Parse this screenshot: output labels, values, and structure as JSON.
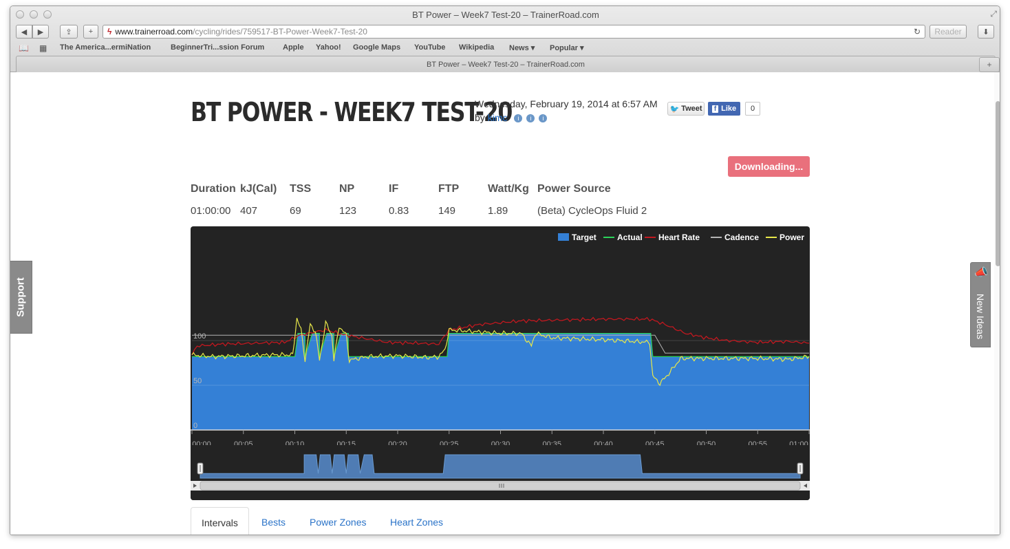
{
  "window": {
    "title": "BT Power – Week7 Test-20 – TrainerRoad.com"
  },
  "toolbar": {
    "url_host": "www.trainerroad.com",
    "url_path": "/cycling/rides/759517-BT-Power-Week7-Test-20",
    "reader_label": "Reader",
    "back_glyph": "◀",
    "forward_glyph": "▶",
    "share_glyph": "⇪",
    "add_glyph": "+",
    "reload_glyph": "↻",
    "download_glyph": "⬇"
  },
  "bookmarks": {
    "items": [
      "The America...ermiNation",
      "BeginnerTri...ssion Forum",
      "Apple",
      "Yahoo!",
      "Google Maps",
      "YouTube",
      "Wikipedia",
      "News ▾",
      "Popular ▾"
    ]
  },
  "tab": {
    "title": "BT Power – Week7 Test-20 – TrainerRoad.com"
  },
  "ride": {
    "title": "BT POWER - WEEK7 TEST-20",
    "date": "Wednesday, February 19, 2014 at 6:57 AM",
    "by_prefix": "by",
    "author": "kimc"
  },
  "social": {
    "tweet_label": "Tweet",
    "like_label": "Like",
    "like_count": "0"
  },
  "actions": {
    "download_label": "Downloading..."
  },
  "stats": {
    "headers": [
      "Duration",
      "kJ(Cal)",
      "TSS",
      "NP",
      "IF",
      "FTP",
      "Watt/Kg",
      "Power Source"
    ],
    "values": [
      "01:00:00",
      "407",
      "69",
      "123",
      "0.83",
      "149",
      "1.89",
      "(Beta) CycleOps Fluid 2"
    ]
  },
  "chart_data": {
    "type": "area",
    "legend": [
      "Target",
      "Actual",
      "Heart Rate",
      "Cadence",
      "Power"
    ],
    "colors": {
      "background": "#232323",
      "target": "#3480d6",
      "actual": "#2bd45a",
      "heart_rate": "#c2181f",
      "cadence": "#b4b4b4",
      "power": "#e8e84a"
    },
    "y_ticks": [
      "100",
      "50",
      "0"
    ],
    "x_tick_labels": [
      "00:00",
      "00:05",
      "00:10",
      "00:15",
      "00:20",
      "00:25",
      "00:30",
      "00:35",
      "00:40",
      "00:45",
      "00:50",
      "00:55",
      "01:00"
    ],
    "xlim_minutes": [
      0,
      60
    ],
    "target_pct": [
      [
        0,
        82
      ],
      [
        10,
        82
      ],
      [
        10.3,
        108
      ],
      [
        11,
        108
      ],
      [
        11,
        82
      ],
      [
        11.7,
        108
      ],
      [
        12.4,
        108
      ],
      [
        12.4,
        82
      ],
      [
        13.1,
        108
      ],
      [
        13.8,
        108
      ],
      [
        13.8,
        82
      ],
      [
        14.5,
        108
      ],
      [
        15.2,
        108
      ],
      [
        15.2,
        82
      ],
      [
        24.8,
        82
      ],
      [
        25,
        108
      ],
      [
        44.6,
        108
      ],
      [
        44.8,
        82
      ],
      [
        60,
        82
      ]
    ],
    "power_pct": [
      [
        0,
        84
      ],
      [
        2,
        82
      ],
      [
        5,
        83
      ],
      [
        8,
        84
      ],
      [
        9.8,
        84
      ],
      [
        10.2,
        125
      ],
      [
        10.6,
        112
      ],
      [
        11,
        78
      ],
      [
        11.5,
        118
      ],
      [
        12,
        110
      ],
      [
        12.4,
        78
      ],
      [
        13,
        120
      ],
      [
        13.6,
        106
      ],
      [
        13.8,
        78
      ],
      [
        14.3,
        116
      ],
      [
        15,
        106
      ],
      [
        15.3,
        78
      ],
      [
        17,
        82
      ],
      [
        20,
        83
      ],
      [
        23,
        81
      ],
      [
        24,
        82
      ],
      [
        24.6,
        90
      ],
      [
        25,
        112
      ],
      [
        30,
        108
      ],
      [
        32,
        108
      ],
      [
        33,
        94
      ],
      [
        33.4,
        108
      ],
      [
        35,
        103
      ],
      [
        40,
        101
      ],
      [
        44.5,
        98
      ],
      [
        44.8,
        60
      ],
      [
        45.5,
        52
      ],
      [
        46.5,
        65
      ],
      [
        47.5,
        80
      ],
      [
        50,
        80
      ],
      [
        55,
        80
      ],
      [
        58,
        79
      ],
      [
        60,
        82
      ]
    ],
    "heart_rate_pct": [
      [
        0,
        84
      ],
      [
        0.5,
        94
      ],
      [
        3,
        96
      ],
      [
        6,
        97
      ],
      [
        9,
        98
      ],
      [
        10.5,
        106
      ],
      [
        13,
        112
      ],
      [
        15,
        106
      ],
      [
        17,
        102
      ],
      [
        19,
        98
      ],
      [
        22,
        97
      ],
      [
        24,
        96
      ],
      [
        25,
        112
      ],
      [
        28,
        118
      ],
      [
        32,
        122
      ],
      [
        36,
        123
      ],
      [
        40,
        124
      ],
      [
        44.5,
        124
      ],
      [
        46,
        118
      ],
      [
        48,
        108
      ],
      [
        50,
        103
      ],
      [
        52,
        100
      ],
      [
        55,
        98
      ],
      [
        58,
        99
      ],
      [
        60,
        97
      ]
    ],
    "cadence_pct": [
      [
        0,
        106
      ],
      [
        45,
        106
      ],
      [
        46,
        86
      ],
      [
        60,
        86
      ]
    ],
    "navigator_target": [
      [
        0,
        0.2
      ],
      [
        10.4,
        0.2
      ],
      [
        10.4,
        1
      ],
      [
        11.6,
        1
      ],
      [
        11.8,
        0.2
      ],
      [
        12.0,
        1
      ],
      [
        13.0,
        1
      ],
      [
        13.2,
        0.2
      ],
      [
        13.4,
        1
      ],
      [
        14.4,
        1
      ],
      [
        14.6,
        0.2
      ],
      [
        14.8,
        1
      ],
      [
        15.8,
        1
      ],
      [
        16.0,
        0.2
      ],
      [
        16.4,
        1
      ],
      [
        17.2,
        1
      ],
      [
        17.4,
        0.2
      ],
      [
        24.3,
        0.2
      ],
      [
        24.5,
        1
      ],
      [
        44.0,
        1
      ],
      [
        44.2,
        0.2
      ],
      [
        60,
        0.2
      ]
    ]
  },
  "tabs": [
    "Intervals",
    "Bests",
    "Power Zones",
    "Heart Zones"
  ],
  "sidebar": {
    "support_label": "Support",
    "ideas_label": "New Ideas"
  }
}
